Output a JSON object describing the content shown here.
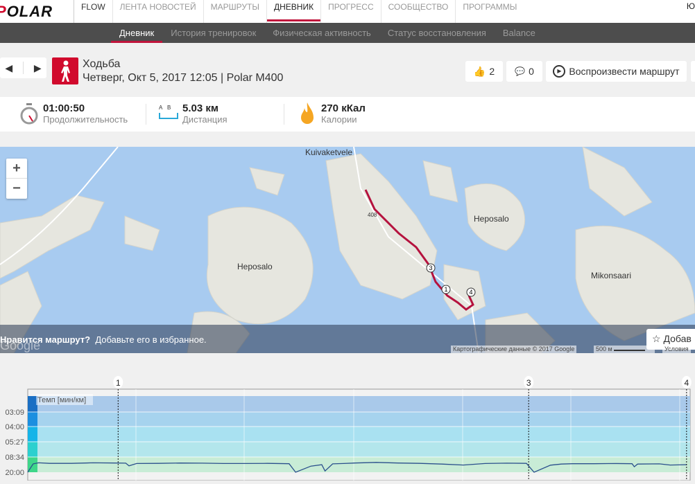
{
  "topnav": {
    "logo": "POLAR",
    "items": [
      "FLOW",
      "ЛЕНТА НОВОСТЕЙ",
      "МАРШРУТЫ",
      "ДНЕВНИК",
      "ПРОГРЕСС",
      "СООБЩЕСТВО",
      "ПРОГРАММЫ"
    ],
    "active": "ДНЕВНИК",
    "user": "Ю"
  },
  "subnav": {
    "items": [
      "Дневник",
      "История тренировок",
      "Физическая активность",
      "Статус восстановления",
      "Balance"
    ],
    "active": "Дневник"
  },
  "session": {
    "sport_icon": "walking-person-icon",
    "sport": "Ходьба",
    "datetime": "Четверг, Окт 5, 2017 12:05 | Polar M400"
  },
  "actions": {
    "likes": "2",
    "comments": "0",
    "replay": "Воспроизвести маршрут"
  },
  "stats": {
    "duration": {
      "value": "01:00:50",
      "label": "Продолжительность"
    },
    "distance": {
      "value": "5.03 км",
      "label": "Дистанция",
      "ab_a": "A",
      "ab_b": "B"
    },
    "calories": {
      "value": "270 кКал",
      "label": "Калории"
    }
  },
  "map": {
    "labels": [
      "Kuivaketvele",
      "Heposalo",
      "Heposalo",
      "Mikonsaari"
    ],
    "road": "408",
    "markers": [
      "1",
      "3",
      "4"
    ],
    "zoom_in": "+",
    "zoom_out": "−",
    "promo_bold": "Нравится маршрут?",
    "promo_text": "Добавьте его в избранное.",
    "favorite": "Добав",
    "attribution": "Картографические данные © 2017 Google",
    "scale": "500 м",
    "terms": "Условия",
    "google": "Google",
    "route_color": "#b5123e"
  },
  "chart_data": {
    "type": "line",
    "series_label": "Темп [мин/км]",
    "yticks": [
      "03:09",
      "04:00",
      "05:27",
      "08:34",
      "20:00"
    ],
    "laps": [
      {
        "label": "1",
        "t": 8.3
      },
      {
        "label": "3",
        "t": 46
      },
      {
        "label": "4",
        "t": 60.5
      }
    ],
    "xlim": [
      0,
      60.83
    ],
    "x": [
      0,
      0.5,
      1,
      2,
      4,
      6,
      8,
      9,
      9.3,
      10,
      12,
      14,
      16,
      18,
      20,
      22,
      24,
      24.6,
      26,
      27,
      27.3,
      28,
      29,
      30,
      32,
      34,
      36,
      38,
      40,
      42,
      44,
      45.8,
      46.5,
      48,
      49,
      50,
      52,
      54,
      55.5,
      55.7,
      56,
      58,
      59,
      60.5
    ],
    "pace": [
      20,
      11.5,
      10.9,
      11.2,
      11.2,
      10.9,
      11,
      11.1,
      12.8,
      11.3,
      11.2,
      11,
      11.1,
      11.3,
      11.3,
      11.2,
      11.4,
      20,
      13,
      12,
      18,
      11.5,
      11.3,
      11,
      10.7,
      11,
      11.2,
      11.6,
      12.2,
      11.3,
      11.1,
      11.2,
      20,
      12.3,
      11.6,
      11.4,
      11.4,
      11.3,
      11.4,
      13.5,
      11.6,
      11.5,
      12.2,
      12
    ]
  }
}
